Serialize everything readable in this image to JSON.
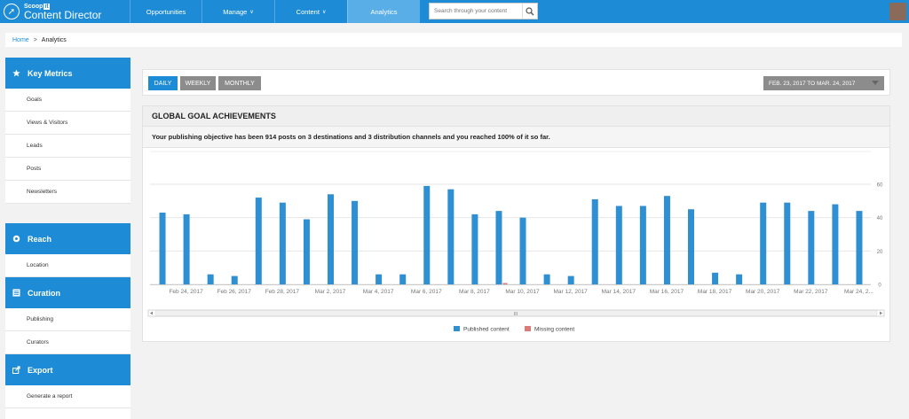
{
  "nav": {
    "logo_top": "Scoop",
    "logo_it": "it",
    "logo_main": "Content Director",
    "items": [
      {
        "label": "Opportunities",
        "caret": false,
        "active": false
      },
      {
        "label": "Manage",
        "caret": true,
        "active": false
      },
      {
        "label": "Content",
        "caret": true,
        "active": false
      },
      {
        "label": "Analytics",
        "caret": false,
        "active": true
      }
    ],
    "search_placeholder": "Search through your content"
  },
  "breadcrumb": {
    "home": "Home",
    "separator": ">",
    "current": "Analytics"
  },
  "sidebar": {
    "sections": [
      {
        "title": "Key Metrics",
        "icon": "star-icon",
        "items": [
          "Goals",
          "Views & Visitors",
          "Leads",
          "Posts",
          "Newsletters"
        ]
      },
      {
        "title": "Reach",
        "icon": "target-icon",
        "items": [
          "Location"
        ]
      },
      {
        "title": "Curation",
        "icon": "list-icon",
        "items": [
          "Publishing",
          "Curators"
        ]
      },
      {
        "title": "Export",
        "icon": "export-icon",
        "items": [
          "Generate a report"
        ]
      }
    ]
  },
  "toolbar": {
    "periods": [
      {
        "label": "DAILY",
        "active": true
      },
      {
        "label": "WEEKLY",
        "active": false
      },
      {
        "label": "MONTHLY",
        "active": false
      }
    ],
    "date_range": "FEB. 23, 2017 TO MAR. 24, 2017"
  },
  "goal": {
    "title": "GLOBAL GOAL ACHIEVEMENTS",
    "description": "Your publishing objective has been 914 posts on 3 destinations and 3 distribution channels and you reached 100% of it so far."
  },
  "colors": {
    "accent": "#1d8bd6",
    "published": "#2f8fd3",
    "missing": "#e07a78",
    "inactive_button": "#8c8c8c"
  },
  "chart_data": {
    "type": "bar",
    "x": [
      "Feb 23, 2017",
      "Feb 24, 2017",
      "Feb 25, 2017",
      "Feb 26, 2017",
      "Feb 27, 2017",
      "Feb 28, 2017",
      "Mar 1, 2017",
      "Mar 2, 2017",
      "Mar 3, 2017",
      "Mar 4, 2017",
      "Mar 5, 2017",
      "Mar 6, 2017",
      "Mar 7, 2017",
      "Mar 8, 2017",
      "Mar 9, 2017",
      "Mar 10, 2017",
      "Mar 11, 2017",
      "Mar 12, 2017",
      "Mar 13, 2017",
      "Mar 14, 2017",
      "Mar 15, 2017",
      "Mar 16, 2017",
      "Mar 17, 2017",
      "Mar 18, 2017",
      "Mar 19, 2017",
      "Mar 20, 2017",
      "Mar 21, 2017",
      "Mar 22, 2017",
      "Mar 23, 2017",
      "Mar 24, 2017"
    ],
    "tick_labels": [
      "Feb 24, 2017",
      "Feb 26, 2017",
      "Feb 28, 2017",
      "Mar 2, 2017",
      "Mar 4, 2017",
      "Mar 6, 2017",
      "Mar 8, 2017",
      "Mar 10, 2017",
      "Mar 12, 2017",
      "Mar 14, 2017",
      "Mar 16, 2017",
      "Mar 18, 2017",
      "Mar 20, 2017",
      "Mar 22, 2017",
      "Mar 24, 2..."
    ],
    "series": [
      {
        "name": "Published content",
        "values": [
          43,
          42,
          6,
          5,
          52,
          49,
          39,
          54,
          50,
          6,
          6,
          59,
          57,
          42,
          44,
          40,
          6,
          5,
          51,
          47,
          47,
          53,
          45,
          7,
          6,
          49,
          49,
          44,
          48,
          44
        ]
      },
      {
        "name": "Missing content",
        "values": [
          0,
          0,
          0,
          0,
          0,
          0,
          0,
          0,
          0,
          0,
          0,
          0,
          0,
          0,
          1,
          0,
          0,
          0,
          0,
          0,
          0,
          0,
          0,
          0,
          0,
          0,
          0,
          0,
          0,
          0
        ]
      }
    ],
    "yticks": [
      0,
      20,
      40,
      60
    ],
    "ylim": [
      0,
      60
    ],
    "y_axis_side": "right",
    "grid": true,
    "legend": "bottom-center",
    "scrollbar_label": "III"
  }
}
